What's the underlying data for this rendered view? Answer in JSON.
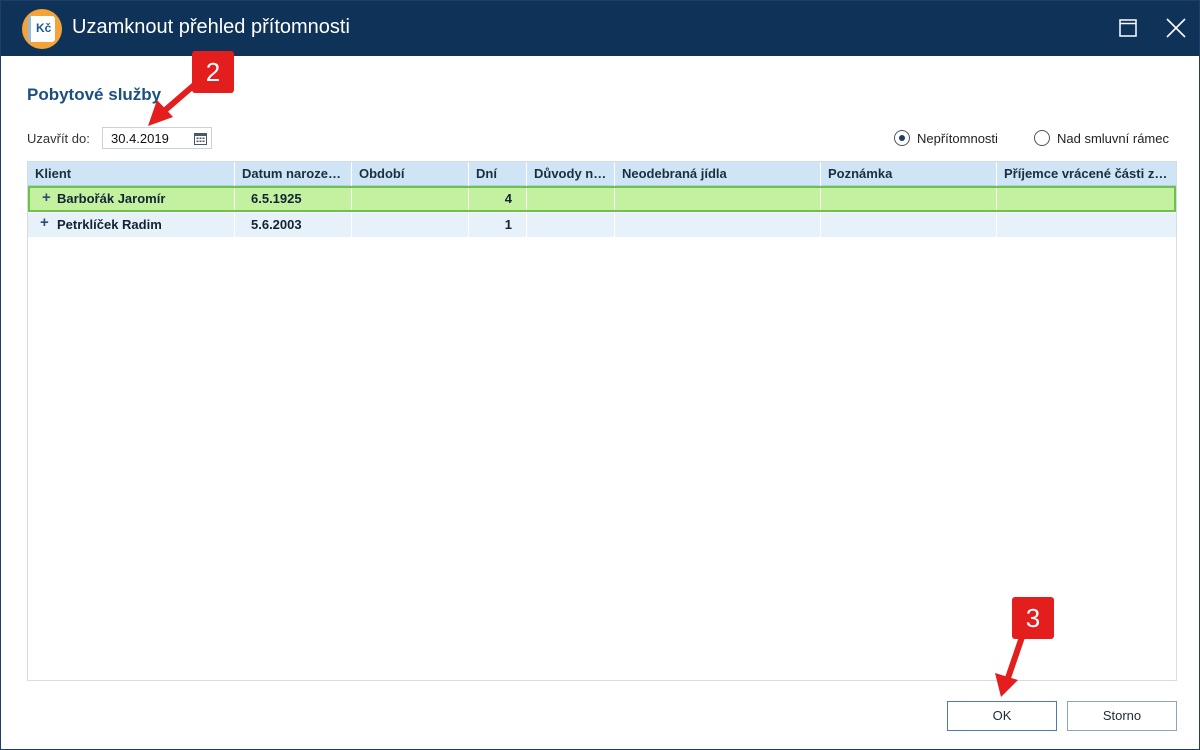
{
  "window": {
    "title": "Uzamknout přehled přítomnosti",
    "app_icon_text": "Kč",
    "controls": [
      "maximize-icon",
      "close-icon"
    ]
  },
  "section_title": "Pobytové služby",
  "filter": {
    "date_label": "Uzavřít do:",
    "date_value": "30.4.2019",
    "radio_options": [
      {
        "label": "Nepřítomnosti",
        "selected": true
      },
      {
        "label": "Nad smluvní rámec",
        "selected": false
      }
    ]
  },
  "grid": {
    "columns": [
      "Klient",
      "Datum naroze…",
      "Období",
      "Dní",
      "Důvody n…",
      "Neodebraná jídla",
      "Poznámka",
      "Příjemce vrácené části z…"
    ],
    "rows": [
      {
        "client": "Barbořák Jaromír",
        "birth": "6.5.1925",
        "period": "",
        "days": "4",
        "reasons": "",
        "meals": "",
        "note": "",
        "recipient": "",
        "selected": true
      },
      {
        "client": "Petrklíček Radim",
        "birth": "5.6.2003",
        "period": "",
        "days": "1",
        "reasons": "",
        "meals": "",
        "note": "",
        "recipient": "",
        "selected": false
      }
    ]
  },
  "buttons": {
    "ok": "OK",
    "cancel": "Storno"
  },
  "annotations": {
    "step2": "2",
    "step3": "3"
  },
  "colors": {
    "titlebar": "#0e3258",
    "header": "#cfe4f4",
    "selected_row": "#c3f1a0",
    "selected_border": "#6cc24a",
    "badge": "#e41d1d"
  }
}
